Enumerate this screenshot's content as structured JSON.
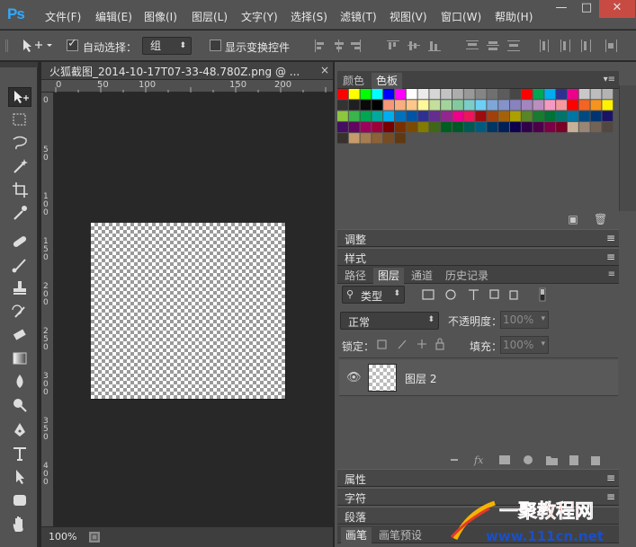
{
  "app": {
    "logo": "Ps",
    "accent": "#31a8ff",
    "win_min": "—",
    "win_max": "□",
    "win_close": "✕"
  },
  "menu": [
    "文件(F)",
    "编辑(E)",
    "图像(I)",
    "图层(L)",
    "文字(Y)",
    "选择(S)",
    "滤镜(T)",
    "视图(V)",
    "窗口(W)",
    "帮助(H)"
  ],
  "options": {
    "auto_select_label": "自动选择：",
    "auto_select_value": "组",
    "show_transform_label": "显示变换控件",
    "auto_select_checked": true,
    "show_transform_checked": false
  },
  "document": {
    "tab_title": "火狐截图_2014-10-17T07-33-48.780Z.png @ ...",
    "close": "×",
    "zoom": "100%",
    "ruler_top": [
      "0",
      "50",
      "100",
      "150",
      "200"
    ],
    "ruler_left": [
      "0",
      "5",
      "0",
      "1",
      "0",
      "0",
      "1",
      "5",
      "0",
      "2",
      "0",
      "0",
      "2",
      "5",
      "0",
      "3",
      "0",
      "0",
      "3",
      "5",
      "0",
      "4",
      "0",
      "0"
    ]
  },
  "swatches": {
    "tabs": [
      "颜色",
      "色板"
    ],
    "active_tab": "色板",
    "colors": [
      [
        "#ff0000",
        "#ffff00",
        "#00ff00",
        "#00ffff",
        "#0000ff",
        "#ff00ff",
        "#ffffff",
        "#ebebeb",
        "#d6d6d6",
        "#c2c2c2",
        "#adadad",
        "#999999",
        "#858585",
        "#707070",
        "#5c5c5c",
        "#474747",
        "#ff0000",
        "#00a651",
        "#00aeef",
        "#2e3192",
        "#ec008c",
        "#c8c8c8",
        "#bdbdbd",
        "#b3b3b3"
      ],
      [
        "#333333",
        "#1f1f1f",
        "#0a0a0a",
        "#000000",
        "#f7977a",
        "#f9ad81",
        "#fdc68a",
        "#fff79a",
        "#c4df9b",
        "#a2d39c",
        "#82ca9d",
        "#7bcdc8",
        "#6ecff6",
        "#7ea7d8",
        "#8493ca",
        "#8882be",
        "#a187be",
        "#bc8dbf",
        "#f49ac2",
        "#f6989d",
        "#ff0000",
        "#f26522",
        "#f7941d",
        "#fff200"
      ],
      [
        "#8dc63f",
        "#39b54a",
        "#00a651",
        "#00a99d",
        "#00aeef",
        "#0072bc",
        "#0054a6",
        "#2e3192",
        "#662d91",
        "#92278f",
        "#ec008c",
        "#ed145b",
        "#9e0b0f",
        "#a0410d",
        "#a3620a",
        "#aba000",
        "#598527",
        "#197b30",
        "#007236",
        "#00746b",
        "#0076a3",
        "#004a80",
        "#003471",
        "#1b1464"
      ],
      [
        "#440e62",
        "#630460",
        "#9e005d",
        "#9e0039",
        "#790000",
        "#7b2e00",
        "#7d4900",
        "#827b00",
        "#406618",
        "#005e20",
        "#005826",
        "#005952",
        "#005b7f",
        "#003663",
        "#002157",
        "#0d004c",
        "#32004b",
        "#4b0049",
        "#7b0046",
        "#7a0026",
        "#c7b299",
        "#998675",
        "#736357",
        "#534741"
      ],
      [
        "#37302d",
        "#c69c6d",
        "#a67c52",
        "#8c6239",
        "#754c24",
        "#603913"
      ]
    ]
  },
  "panels": {
    "adjust": "调整",
    "styles": "样式",
    "properties": "属性",
    "character": "字符",
    "paragraph": "段落",
    "bottom_tabs": [
      "画笔",
      "画笔预设"
    ],
    "layers": {
      "tabs": [
        "路径",
        "图层",
        "通道",
        "历史记录"
      ],
      "active_tab": "图层",
      "filter_label": "类型",
      "blend_mode": "正常",
      "opacity_label": "不透明度：",
      "opacity_value": "100%",
      "lock_label": "锁定：",
      "fill_label": "填充：",
      "fill_value": "100%",
      "items": [
        {
          "name": "图层 2",
          "visible": true
        }
      ]
    }
  },
  "watermark": {
    "brand": "一聚教程网",
    "url": "www.111cn.net"
  }
}
